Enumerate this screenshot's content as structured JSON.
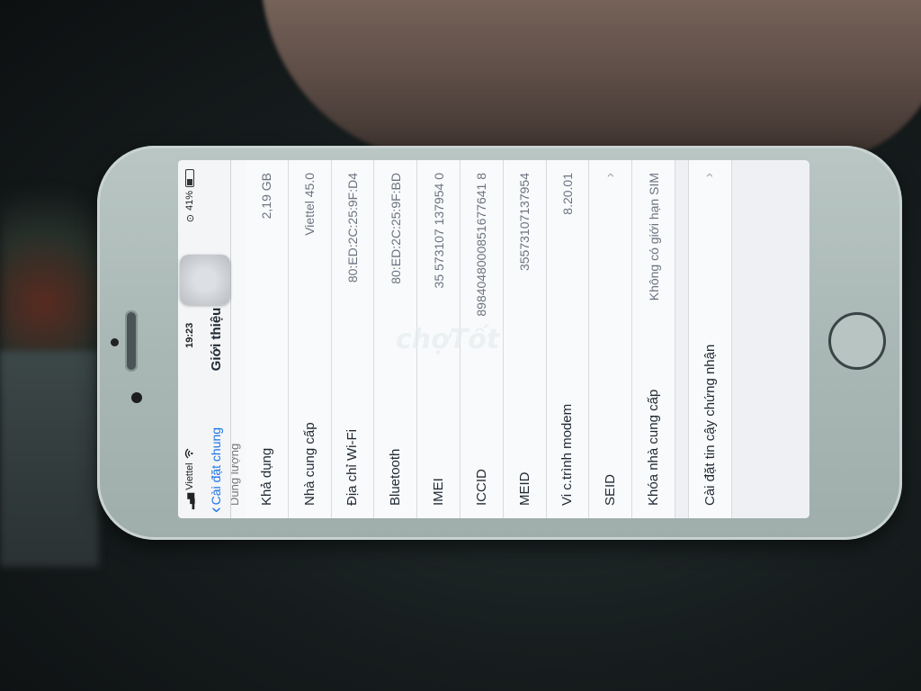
{
  "status_bar": {
    "carrier": "Viettel",
    "time": "19:23",
    "battery": "41%"
  },
  "nav": {
    "back_label": "Cài đặt chung",
    "title": "Giới thiệu"
  },
  "about_rows": [
    {
      "label": "Khả dụng",
      "value": "2,19 GB"
    },
    {
      "label": "Nhà cung cấp",
      "value": "Viettel 45.0"
    },
    {
      "label": "Địa chỉ Wi-Fi",
      "value": "80:ED:2C:25:9F:D4"
    },
    {
      "label": "Bluetooth",
      "value": "80:ED:2C:25:9F:BD"
    },
    {
      "label": "IMEI",
      "value": "35 573107 137954 0"
    },
    {
      "label": "ICCID",
      "value": "8984048000851677641 8"
    },
    {
      "label": "MEID",
      "value": "35573107137954"
    },
    {
      "label": "Vi c.trình modem",
      "value": "8.20.01"
    },
    {
      "label": "SEID",
      "value": ""
    },
    {
      "label": "Khóa nhà cung cấp",
      "value": "Không có giới hạn SIM"
    }
  ],
  "cert_row": {
    "label": "Cài đặt tin cậy chứng nhận"
  },
  "watermark": "chợTốt",
  "icons": {
    "back": "chevron-left-icon",
    "chevron": "chevron-right-icon",
    "wifi": "wifi-icon",
    "battery": "battery-icon"
  }
}
